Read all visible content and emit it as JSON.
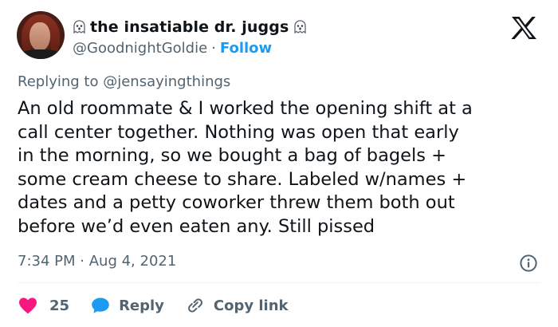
{
  "header": {
    "display_name": "the insatiable dr. juggs",
    "handle": "@GoodnightGoldie",
    "separator": "·",
    "follow_label": "Follow",
    "name_emoji": "ghost-icon",
    "platform_icon": "x-logo-icon"
  },
  "reply": {
    "prefix": "Replying to",
    "mention": "@jensayingthings"
  },
  "body": {
    "lines": [
      "An old roommate & I worked the opening shift at a",
      "call center together. Nothing was open that early",
      "in the morning, so we bought a bag of bagels +",
      "some cream cheese to share. Labeled w/names +",
      "dates and a petty coworker threw them both out",
      "before we’d even eaten any. Still pissed"
    ]
  },
  "meta": {
    "time": "7:34 PM",
    "separator": "·",
    "date": "Aug 4, 2021",
    "info_icon": "info-icon"
  },
  "actions": {
    "like_count": "25",
    "reply_label": "Reply",
    "copy_link_label": "Copy link"
  },
  "colors": {
    "accent": "#1d9bf0",
    "like": "#f91880",
    "secondary_text": "#536471",
    "primary_text": "#0f1419"
  }
}
